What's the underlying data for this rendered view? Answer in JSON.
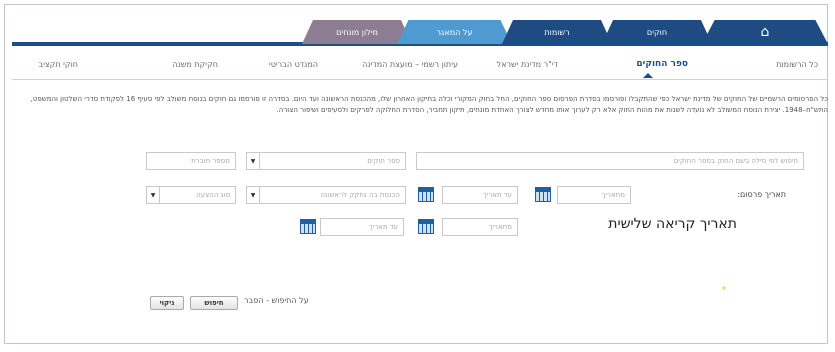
{
  "top_tabs": {
    "home_icon": "home-icon",
    "laws": "חוקים",
    "records": "רשומות",
    "about": "על המאגר",
    "glossary": "מילון מונחים"
  },
  "subnav": {
    "items": [
      "כל הרשומות",
      "ספר החוקים",
      "די\"ר מדינת ישראל",
      "עיתון רשמי – מועצת המדינה",
      "המנדט הבריטי",
      "חקיקת משנה",
      "חוקי תקציב"
    ]
  },
  "description": "כל הפרסומים הרשמיים של החוקים של מדינת ישראל כפי שהתקבלו ופורסמו בסדרת הפרסום ספר החוקים, החל בחוק המקורי וכלה בתיקון האחרון שלו, מהכנסת הראשונה ועד היום. בסדרה זו פורסמו גם חוקים בנוסח משולב לפי סעיף 16 לפקודת סדרי השלטון והמשפט, התש\"ח–1948. יצירת הנוסח המשולב לא נועדה לשנות את מהות החוק אלא רק לערוך אותו מחדש לצורך האחדת מונחים, תיקון תחביר, הסדרת החלוקה לפרקים ולסעיפים ושיפור הצורה.",
  "form": {
    "search_placeholder": "חיפוש לפי מילה בשם החוק בספר החוקים",
    "law_book_placeholder": "ספר חוקים",
    "booklet_placeholder": "מספר חוברת",
    "publish_date_label": "תאריך פרסום:",
    "from_date_placeholder": "מתאריך",
    "to_date_placeholder": "עד תאריך",
    "first_knesset_placeholder": "הכנסת בה נחקק לראשונה",
    "publication_type_placeholder": "סוג ההצעה",
    "third_reading_label": "תאריך קריאה שלישית",
    "from_date2_placeholder": "מתאריך",
    "to_date2_placeholder": "עד תאריך"
  },
  "help_link": "על החיפוש - הסבר",
  "buttons": {
    "search": "חיפוש",
    "clear": "ניקוי"
  }
}
